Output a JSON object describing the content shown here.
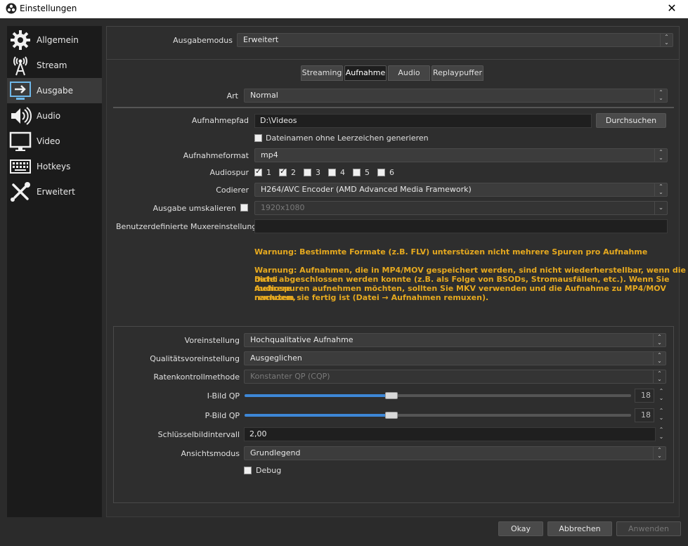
{
  "window": {
    "title": "Einstellungen",
    "close_glyph": "✕",
    "logo_icon": "obs-logo-icon"
  },
  "sidebar": {
    "items": [
      {
        "label": "Allgemein",
        "icon": "gear-icon"
      },
      {
        "label": "Stream",
        "icon": "broadcast-tower-icon"
      },
      {
        "label": "Ausgabe",
        "icon": "output-monitor-icon",
        "selected": true
      },
      {
        "label": "Audio",
        "icon": "speaker-icon"
      },
      {
        "label": "Video",
        "icon": "monitor-icon"
      },
      {
        "label": "Hotkeys",
        "icon": "keyboard-icon"
      },
      {
        "label": "Erweitert",
        "icon": "wrench-screwdriver-icon"
      }
    ]
  },
  "output_mode": {
    "label": "Ausgabemodus",
    "value": "Erweitert"
  },
  "tabs": [
    {
      "label": "Streaming"
    },
    {
      "label": "Aufnahme",
      "selected": true
    },
    {
      "label": "Audio"
    },
    {
      "label": "Replaypuffer"
    }
  ],
  "recording": {
    "type": {
      "label": "Art",
      "value": "Normal"
    },
    "path": {
      "label": "Aufnahmepfad",
      "value": "D:\\Videos",
      "browse_label": "Durchsuchen"
    },
    "no_spaces": {
      "label": "Dateinamen ohne Leerzeichen generieren",
      "checked": false
    },
    "format": {
      "label": "Aufnahmeformat",
      "value": "mp4"
    },
    "audio_tracks": {
      "label": "Audiospur",
      "tracks": [
        {
          "label": "1",
          "checked": true
        },
        {
          "label": "2",
          "checked": true
        },
        {
          "label": "3",
          "checked": false
        },
        {
          "label": "4",
          "checked": false
        },
        {
          "label": "5",
          "checked": false
        },
        {
          "label": "6",
          "checked": false
        }
      ]
    },
    "encoder": {
      "label": "Codierer",
      "value": "H264/AVC Encoder (AMD Advanced Media Framework)"
    },
    "rescale": {
      "label": "Ausgabe umskalieren",
      "checked": false,
      "value": "1920x1080"
    },
    "muxer": {
      "label": "Benutzerdefinierte Muxereinstellungen",
      "value": ""
    },
    "warning1": "Warnung: Bestimmte Formate (z.B. FLV) unterstüzen nicht mehrere Spuren pro Aufnahme",
    "warning2_lines": [
      "Warnung: Aufnahmen, die in MP4/MOV gespeichert werden, sind nicht wiederherstellbar, wenn die Datei",
      "nicht abgeschlossen werden konnte (z.B. als Folge von BSODs, Stromausfällen, etc.). Wenn Sie mehrere",
      "Audiospuren aufnehmen möchten, sollten Sie MKV verwenden und die Aufnahme zu MP4/MOV remuxen,",
      "nachdem sie fertig ist (Datei → Aufnahmen remuxen)."
    ]
  },
  "encoder_settings": {
    "preset": {
      "label": "Voreinstellung",
      "value": "Hochqualitative Aufnahme"
    },
    "quality_preset": {
      "label": "Qualitätsvoreinstellung",
      "value": "Ausgeglichen"
    },
    "rate_control": {
      "label": "Ratenkontrollmethode",
      "value": "Konstanter QP (CQP)"
    },
    "i_qp": {
      "label": "I-Bild QP",
      "value": "18",
      "fraction": 0.38
    },
    "p_qp": {
      "label": "P-Bild QP",
      "value": "18",
      "fraction": 0.38
    },
    "keyframe": {
      "label": "Schlüsselbildintervall",
      "value": "2,00"
    },
    "view_mode": {
      "label": "Ansichtsmodus",
      "value": "Grundlegend"
    },
    "debug": {
      "label": "Debug",
      "checked": false
    }
  },
  "footer": {
    "ok_label": "Okay",
    "cancel_label": "Abbrechen",
    "apply_label": "Anwenden"
  }
}
